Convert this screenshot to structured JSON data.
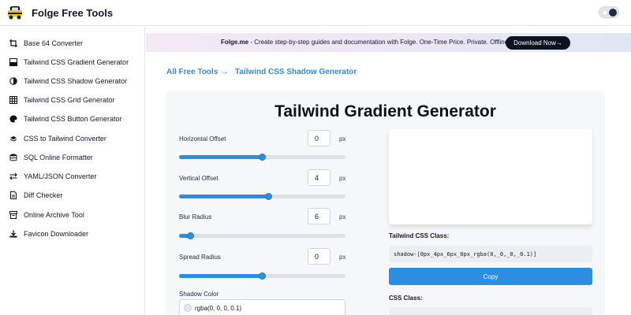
{
  "app": {
    "title": "Folge Free Tools"
  },
  "sidebar": {
    "items": [
      {
        "label": "Base 64 Converter",
        "icon": "crop-icon"
      },
      {
        "label": "Tailwind CSS Gradient Generator",
        "icon": "gradient-icon"
      },
      {
        "label": "Tailwind CSS Shadow Generator",
        "icon": "shadow-icon"
      },
      {
        "label": "Tailwind CSS Grid Generator",
        "icon": "grid-icon"
      },
      {
        "label": "Tailwind CSS Button Generator",
        "icon": "palette-icon"
      },
      {
        "label": "CSS to Tailwind Converter",
        "icon": "layers-icon"
      },
      {
        "label": "SQL Online Formatter",
        "icon": "database-icon"
      },
      {
        "label": "YAML/JSON Converter",
        "icon": "swap-icon"
      },
      {
        "label": "Diff Checker",
        "icon": "file-icon"
      },
      {
        "label": "Online Archive Tool",
        "icon": "archive-icon"
      },
      {
        "label": "Favicon Downloader",
        "icon": "download-icon"
      }
    ]
  },
  "banner": {
    "brand": "Folge.me",
    "text": " - Create step-by-step guides and documentation with Folge. One-Time Price. Private. Offline!",
    "button_label": "Download Now→"
  },
  "breadcrumb": {
    "root": "All Free Tools",
    "separator": "→",
    "current": "Tailwind CSS Shadow Generator"
  },
  "main": {
    "title": "Tailwind Gradient Generator",
    "controls": [
      {
        "label": "Horizontal Offset",
        "value": "0",
        "unit": "px",
        "slider_fraction": 0.5
      },
      {
        "label": "Vertical Offset",
        "value": "4",
        "unit": "px",
        "slider_fraction": 0.54
      },
      {
        "label": "Blur Radius",
        "value": "6",
        "unit": "px",
        "slider_fraction": 0.07
      },
      {
        "label": "Spread Radius",
        "value": "0",
        "unit": "px",
        "slider_fraction": 0.5
      }
    ],
    "shadow_color": {
      "label": "Shadow Color",
      "value": "rgba(0, 0, 0, 0.1)"
    },
    "tailwind_class": {
      "label": "Tailwind CSS Class:",
      "code": "shadow-[0px_4px_6px_0px_rgba(0,_0,_0,_0.1)]",
      "copy_label": "Copy"
    },
    "css_class": {
      "label": "CSS Class:"
    }
  },
  "colors": {
    "accent": "#2b8ee0",
    "button_dark": "#0b1220"
  }
}
